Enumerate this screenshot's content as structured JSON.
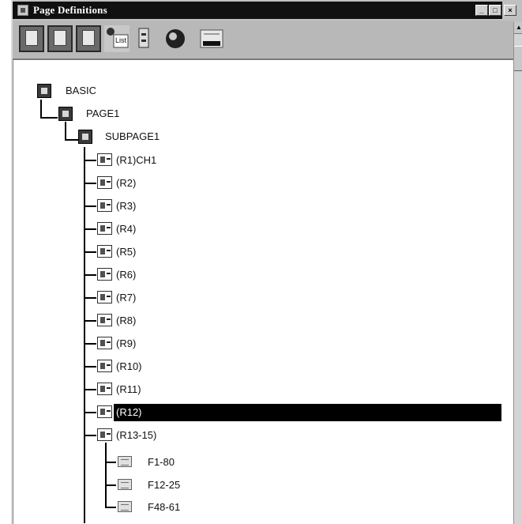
{
  "window": {
    "title": "Page Definitions",
    "controls": {
      "minimize": "_",
      "maximize": "□",
      "close": "×"
    }
  },
  "toolbar": {
    "tools": [
      {
        "name": "new-page",
        "icon": "page-icon"
      },
      {
        "name": "open-page",
        "icon": "page-icon"
      },
      {
        "name": "save-page",
        "icon": "page-icon"
      },
      {
        "name": "field-list",
        "icon": "field-list-icon",
        "label": "List"
      },
      {
        "name": "record",
        "icon": "record-icon"
      },
      {
        "name": "info",
        "icon": "circle-icon"
      },
      {
        "name": "display",
        "icon": "display-icon"
      }
    ]
  },
  "tree": {
    "root": "BASIC",
    "page": "PAGE1",
    "subpage": "SUBPAGE1",
    "records": [
      "(R1)CH1",
      "(R2)",
      "(R3)",
      "(R4)",
      "(R5)",
      "(R6)",
      "(R7)",
      "(R8)",
      "(R9)",
      "(R10)",
      "(R11)",
      "(R12)",
      "(R13-15)"
    ],
    "selected": "(R12)",
    "fields": [
      "F1-80",
      "F12-25",
      "F48-61"
    ]
  }
}
